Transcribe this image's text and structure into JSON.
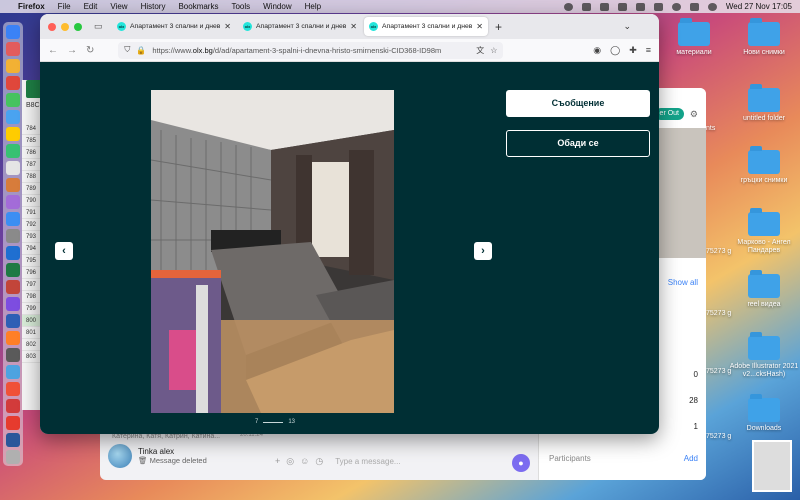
{
  "menubar": {
    "app": "Firefox",
    "items": [
      "File",
      "Edit",
      "View",
      "History",
      "Bookmarks",
      "Tools",
      "Window",
      "Help"
    ],
    "clock": "Wed 27 Nov  17:05"
  },
  "desktop": {
    "items": [
      {
        "label": "материали"
      },
      {
        "label": "Нови снимки"
      },
      {
        "label": "untitled folder"
      },
      {
        "label": "гръцки снимки"
      },
      {
        "label": "Марково - Ангел Пандарев"
      },
      {
        "label": "reel видеа"
      },
      {
        "label": "Adobe Illustrator 2021 v2...cksHash)"
      },
      {
        "label": "Downloads"
      }
    ],
    "partial_labels": [
      "nts",
      "75273 g",
      "75273 g",
      "75273 g",
      "75273 g",
      "75273 g",
      "75273 g"
    ]
  },
  "spreadsheet": {
    "cell_ref": "B8C",
    "rows": [
      "784",
      "785",
      "786",
      "787",
      "788",
      "789",
      "790",
      "791",
      "792",
      "793",
      "794",
      "795",
      "796",
      "797",
      "798",
      "799",
      "800",
      "801",
      "802",
      "803"
    ],
    "selected_row": "800"
  },
  "chat_window": {
    "contact_name": "Tinka alex",
    "contact_message": "Message deleted",
    "contact_date": "20.11.24",
    "prev_line": "Катерина, Катя, Катрин, Катина...",
    "composer_placeholder": "Type a message...",
    "right_panel": {
      "pill": "er Out",
      "show_all": "Show all",
      "counts": [
        "0",
        "28",
        "1"
      ],
      "participants_label": "Participants",
      "add_label": "Add"
    }
  },
  "browser": {
    "tabs": [
      {
        "label": "Апартамент 3 спални и днев",
        "active": false
      },
      {
        "label": "Апартамент 3 спални и днев",
        "active": false
      },
      {
        "label": "Апартамент 3 спални и днев",
        "active": true
      }
    ],
    "favicon_text": "olx",
    "url_prefix": "https://www.",
    "url_domain": "olx.bg",
    "url_path": "/d/ad/apartament-3-spalni-i-dnevna-hristo-smirnenski-CID368-ID98m"
  },
  "gallery": {
    "current": "7",
    "total": "13",
    "message_button": "Съобщение",
    "call_button": "Обади се",
    "prev_icon": "chevron-left-icon",
    "next_icon": "chevron-right-icon",
    "image_subject": "bedroom with grey bed, patterned wallpaper and a baby playpen"
  },
  "colors": {
    "olx_dark": "#002f34",
    "olx_accent": "#23e5db",
    "traffic_red": "#ff5f57",
    "traffic_yellow": "#febc2e",
    "traffic_green": "#28c840"
  }
}
